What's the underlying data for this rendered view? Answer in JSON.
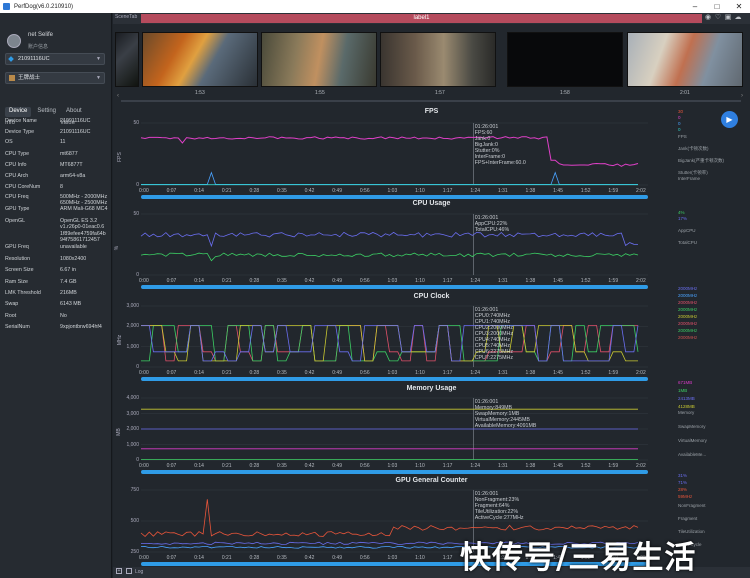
{
  "app": {
    "title": "PerfDog(v6.0.210910)"
  },
  "user": {
    "name": "net Selife",
    "info": "账户信息"
  },
  "device_select": {
    "value": "21091116UC"
  },
  "app_select": {
    "value": "王牌战士"
  },
  "tabs": [
    {
      "label": "Device"
    },
    {
      "label": "Setting"
    },
    {
      "label": "About"
    }
  ],
  "table_header": {
    "key": "Info",
    "value": "Value"
  },
  "device_info": [
    {
      "k": "Device Name",
      "v": "21091116UC"
    },
    {
      "k": "Device Type",
      "v": "21091116UC"
    },
    {
      "k": "OS",
      "v": "11"
    },
    {
      "k": "CPU Type",
      "v": "mt6877"
    },
    {
      "k": "CPU Info",
      "v": "MT6877T"
    },
    {
      "k": "CPU Arch",
      "v": "arm64-v8a"
    },
    {
      "k": "CPU CoreNum",
      "v": "8"
    },
    {
      "k": "CPU Freq",
      "v": "500MHz - 2000MHz\n650MHz - 2500MHz"
    },
    {
      "k": "GPU Type",
      "v": "ARM Mali-G68 MC4"
    },
    {
      "k": "OpenGL",
      "v": "OpenGL ES 3.2\nv1.r26p0-01eac0.6\n1f89efee4759fa64b\n94f75861712457"
    },
    {
      "k": "GPU Freq",
      "v": "unavailable"
    },
    {
      "k": "Resolution",
      "v": "1080x2400"
    },
    {
      "k": "Screen Size",
      "v": "6.67 in"
    },
    {
      "k": "Ram Size",
      "v": "7.4 GB"
    },
    {
      "k": "LMK Threshold",
      "v": "216MB"
    },
    {
      "k": "Swap",
      "v": "6143 MB"
    },
    {
      "k": "Root",
      "v": "No"
    },
    {
      "k": "SerialNum",
      "v": "9xpjontbrw694hf4"
    }
  ],
  "scene": {
    "tab": "SceneTab",
    "label": "label1"
  },
  "thumbnails": [
    {
      "time": "1:53"
    },
    {
      "time": "1:55"
    },
    {
      "time": "1:57"
    },
    {
      "time": "1:58"
    },
    {
      "time": "2:01"
    }
  ],
  "x_ticks": [
    "0:00",
    "0:07",
    "0:14",
    "0:21",
    "0:28",
    "0:35",
    "0:42",
    "0:49",
    "0:56",
    "1:03",
    "1:10",
    "1:17",
    "1:24",
    "1:31",
    "1:38",
    "1:45",
    "1:52",
    "1:59",
    "2:02"
  ],
  "colors": {
    "accent": "#2f9be6",
    "label_bar": "#b54b5d",
    "fps": "#e040c8",
    "jank": "#e8553a",
    "bigjank": "#4aa3ff",
    "stutter": "#32d0c8",
    "appcpu": "#3ccf64",
    "totalcpu": "#6a6ef0",
    "memory": "#d93cc8",
    "swap": "#3ccf64",
    "virtual": "#6a6ef0",
    "available": "#c8c832"
  },
  "charts": [
    {
      "title": "FPS",
      "ylabel": "FPS",
      "ticks": [
        "50",
        "0"
      ],
      "annotation": "01:26:001\nFPS:60\nJank:0\nBigJank:0\nStutter:0%\nInterFrame:0\nFPS+InterFrame:60.0",
      "legend_values": [
        "30",
        "0",
        "0",
        "0"
      ],
      "legend_names": [
        "FPS",
        "Jank(卡顿次数)",
        "BigJank(严重卡顿次数)",
        "Stutter(卡顿率)",
        "InterFrame"
      ]
    },
    {
      "title": "CPU Usage",
      "ylabel": "%",
      "ticks": [
        "50",
        "0"
      ],
      "annotation": "01:26:001\nAppCPU:22%\nTotalCPU:46%",
      "legend_values": [
        "4%",
        "17%"
      ],
      "legend_names": [
        "AppCPU",
        "TotalCPU"
      ]
    },
    {
      "title": "CPU Clock",
      "ylabel": "MHz",
      "ticks": [
        "3,000",
        "2,000",
        "1,000",
        "0"
      ],
      "annotation": "01:26:001\nCPU0:740MHz\nCPU1:740MHz\nCPU2:2000MHz\nCPU3:2000MHz\nCPU4:740MHz\nCPU5:740MHz\nCPU6:2275MHz\nCPU7:2275MHz",
      "legend_values": [
        "2000MHz",
        "2000MHz",
        "2000MHz",
        "2000MHz",
        "2000MHz",
        "2000MHz",
        "2000MHz",
        "2000MHz"
      ],
      "legend_names": []
    },
    {
      "title": "Memory Usage",
      "ylabel": "MB",
      "ticks": [
        "4,000",
        "3,000",
        "2,000",
        "1,000",
        "0"
      ],
      "annotation": "01:26:001\nMemory:849MB\nSwapMemory:1MB\nVirtualMemory:2445MB\nAvailableMemory:4091MB",
      "legend_values": [
        "671MB",
        "1MB",
        "2413MB",
        "4128MB"
      ],
      "legend_names": [
        "Memory",
        "SwapMemory",
        "VirtualMemory",
        "AvailableMe..."
      ]
    },
    {
      "title": "GPU General Counter",
      "ylabel": "",
      "ticks": [
        "750",
        "500",
        "250"
      ],
      "annotation": "01:26:001\nNonFragment:23%\nFragment:64%\nTileUtilization:22%\nActiveCycle:277MHz",
      "legend_values": [
        "31%",
        "71%",
        "28%",
        "59MHz"
      ],
      "legend_names": [
        "NonFragment",
        "Fragment",
        "TileUtilization",
        "ActiveCycle"
      ]
    }
  ],
  "log": {
    "label": "Log"
  },
  "watermark": {
    "text": "快传号/三易生活"
  }
}
